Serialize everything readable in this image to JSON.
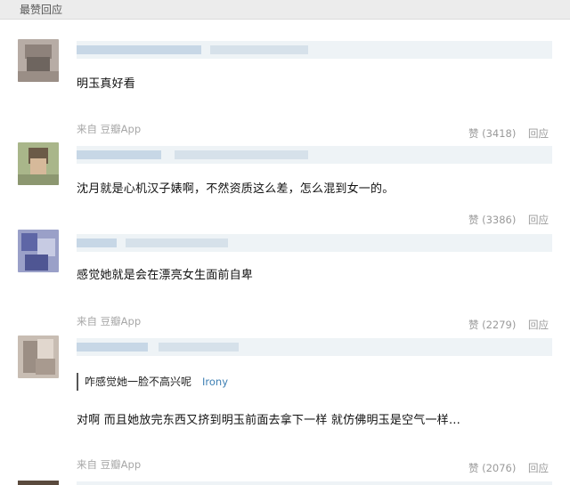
{
  "header": {
    "title": "最赞回应"
  },
  "comments": [
    {
      "text": "明玉真好看",
      "source": "来自 豆瓣App",
      "like_label": "赞 (3418)",
      "reply_label": "回应"
    },
    {
      "text": "沈月就是心机汉子婊啊，不然资质这么差，怎么混到女一的。",
      "like_label": "赞 (3386)",
      "reply_label": "回应"
    },
    {
      "text": "感觉她就是会在漂亮女生面前自卑",
      "source": "来自 豆瓣App",
      "like_label": "赞 (2279)",
      "reply_label": "回应"
    },
    {
      "quote_text": "咋感觉她一脸不高兴呢",
      "quote_user": "Irony",
      "text": "对啊 而且她放完东西又挤到明玉前面去拿下一样 就仿佛明玉是空气一样…",
      "source": "来自 豆瓣App",
      "like_label": "赞 (2076)",
      "reply_label": "回应"
    }
  ],
  "colors": {
    "link": "#3d7fb3",
    "muted": "#9a9a9a",
    "meta_bar": "#eef3f6"
  }
}
